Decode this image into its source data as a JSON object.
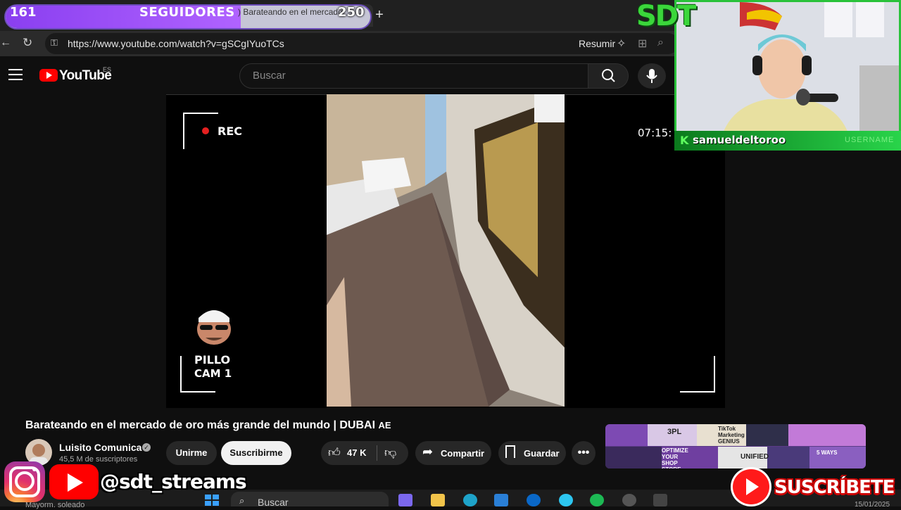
{
  "browser": {
    "tab_title": "Barateando en el mercado",
    "url": "https://www.youtube.com/watch?v=gSCgIYuoTCs",
    "summarize_label": "Resumir"
  },
  "followers_goal": {
    "current": "161",
    "label": "SEGUIDORES",
    "goal": "250",
    "progress": 0.644
  },
  "youtube": {
    "logo_text": "YouTube",
    "region": "ES",
    "search_placeholder": "Buscar"
  },
  "video_overlay": {
    "rec_label": "REC",
    "time": "07:15:",
    "cam_name": "PILLO",
    "cam_id": "CAM 1"
  },
  "video": {
    "title": "Barateando en el mercado de oro más grande del mundo | DUBAI",
    "title_suffix": "AE",
    "channel": "Luisito Comunica",
    "subscribers": "45,5 M de suscriptores",
    "join_label": "Unirme",
    "subscribe_label": "Suscribirme",
    "likes": "47 K",
    "share_label": "Compartir",
    "save_label": "Guardar"
  },
  "recommended_thumbnail": {
    "texts": [
      "3PL",
      "TikTok Marketing GENIUS",
      "OPTIMIZE YOUR SHOP STORE",
      "UNIFIED",
      "5 WAYS"
    ]
  },
  "webcam": {
    "k_badge": "K",
    "username": "samueldeltoroo",
    "username_label": "USERNAME"
  },
  "stream_logo": "SDT",
  "social": {
    "handle": "@sdt_streams",
    "subscribe_cta": "SUSCRÍBETE"
  },
  "taskbar": {
    "search_label": "Buscar",
    "weather_text": "Mayorm. soleado",
    "date": "15/01/2025"
  },
  "colors": {
    "follower_fill": "#8a3ff0",
    "yt_red": "#ff0000",
    "webcam_border": "#29c23a"
  }
}
